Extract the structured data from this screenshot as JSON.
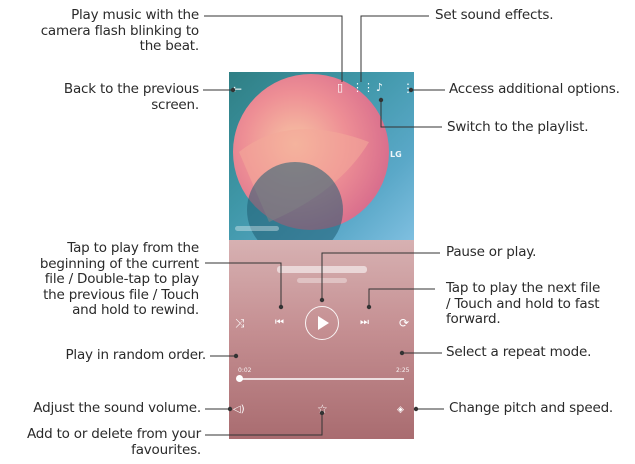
{
  "callouts": {
    "camera_flash": "Play music with the\ncamera flash blinking to\nthe beat.",
    "back": "Back to the previous\nscreen.",
    "sound_effects": "Set sound effects.",
    "options": "Access additional options.",
    "playlist": "Switch to the playlist.",
    "tap_play": "Tap to play from the\nbeginning of the current\nfile / Double-tap to play\nthe previous file / Touch\nand hold to rewind.",
    "pause_play": "Pause or play.",
    "next": "Tap to play the next file\n/ Touch and hold to fast\nforward.",
    "random": "Play in random order.",
    "repeat": "Select a repeat mode.",
    "volume": "Adjust the sound volume.",
    "pitch": "Change pitch and speed.",
    "favourites": "Add to or delete from your\nfavourites."
  },
  "player": {
    "brand": "LG",
    "time_start": "0:02",
    "time_end": "2:25"
  },
  "colors": {
    "art_background": "#3f97a8",
    "player_background": "#c58f92",
    "callout_line": "#333333"
  },
  "icons": [
    "back-arrow-icon",
    "camera-flash-icon",
    "equalizer-icon",
    "playlist-icon",
    "more-options-icon",
    "shuffle-icon",
    "previous-icon",
    "play-icon",
    "next-icon",
    "repeat-icon",
    "volume-icon",
    "favourite-star-icon",
    "pitch-speed-icon"
  ]
}
